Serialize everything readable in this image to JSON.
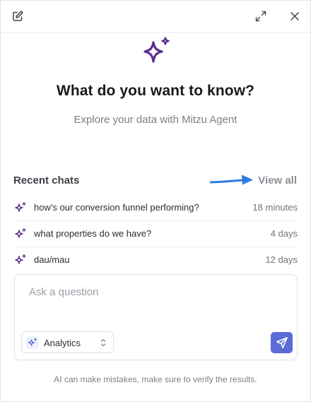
{
  "header": {
    "new_chat_icon": "edit-icon",
    "expand_icon": "expand-icon",
    "close_icon": "close-icon"
  },
  "hero": {
    "icon": "sparkle-icon",
    "icon_color": "#5b2c8f",
    "title": "What do you want to know?",
    "subtitle": "Explore your data with Mitzu Agent"
  },
  "recent": {
    "title": "Recent chats",
    "view_all": "View all",
    "annotation_arrow_color": "#2f7de1",
    "items": [
      {
        "title": "how's our conversion funnel performing?",
        "time": "18 minutes"
      },
      {
        "title": "what properties do we have?",
        "time": "4 days"
      },
      {
        "title": "dau/mau",
        "time": "12 days"
      }
    ]
  },
  "composer": {
    "placeholder": "Ask a question",
    "value": "",
    "mode": "Analytics",
    "send_color": "#5b6bd8"
  },
  "disclaimer": "AI can make mistakes, make sure to verify the results."
}
